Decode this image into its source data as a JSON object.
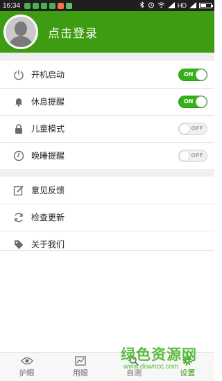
{
  "status_bar": {
    "time": "16:34",
    "network": "HD",
    "notification_colors": [
      "#4caf50",
      "#4caf50",
      "#4caf50",
      "#4caf50",
      "#ff7043",
      "#66bb6a"
    ],
    "battery_level": 0.6
  },
  "header": {
    "login_label": "点击登录",
    "background": "#3e9c12"
  },
  "settings": {
    "toggles": [
      {
        "label": "开机启动",
        "state": "ON",
        "icon": "power-icon"
      },
      {
        "label": "休息提醒",
        "state": "ON",
        "icon": "bell-icon"
      },
      {
        "label": "儿童模式",
        "state": "OFF",
        "icon": "lock-icon"
      },
      {
        "label": "晚睡提醒",
        "state": "OFF",
        "icon": "clock-icon"
      }
    ],
    "actions": [
      {
        "label": "意见反馈",
        "icon": "edit-icon"
      },
      {
        "label": "检查更新",
        "icon": "refresh-icon"
      },
      {
        "label": "关于我们",
        "icon": "tag-icon"
      }
    ]
  },
  "tabs": [
    {
      "label": "护眼",
      "icon": "eye-icon",
      "active": false
    },
    {
      "label": "用眼",
      "icon": "chart-icon",
      "active": false
    },
    {
      "label": "自测",
      "icon": "search-icon",
      "active": false
    },
    {
      "label": "设置",
      "icon": "gear-icon",
      "active": true
    }
  ],
  "watermark": {
    "title": "绿色资源网",
    "url": "www.downcc.com"
  },
  "colors": {
    "accent": "#3e9c12",
    "toggle_on": "#36b119"
  }
}
